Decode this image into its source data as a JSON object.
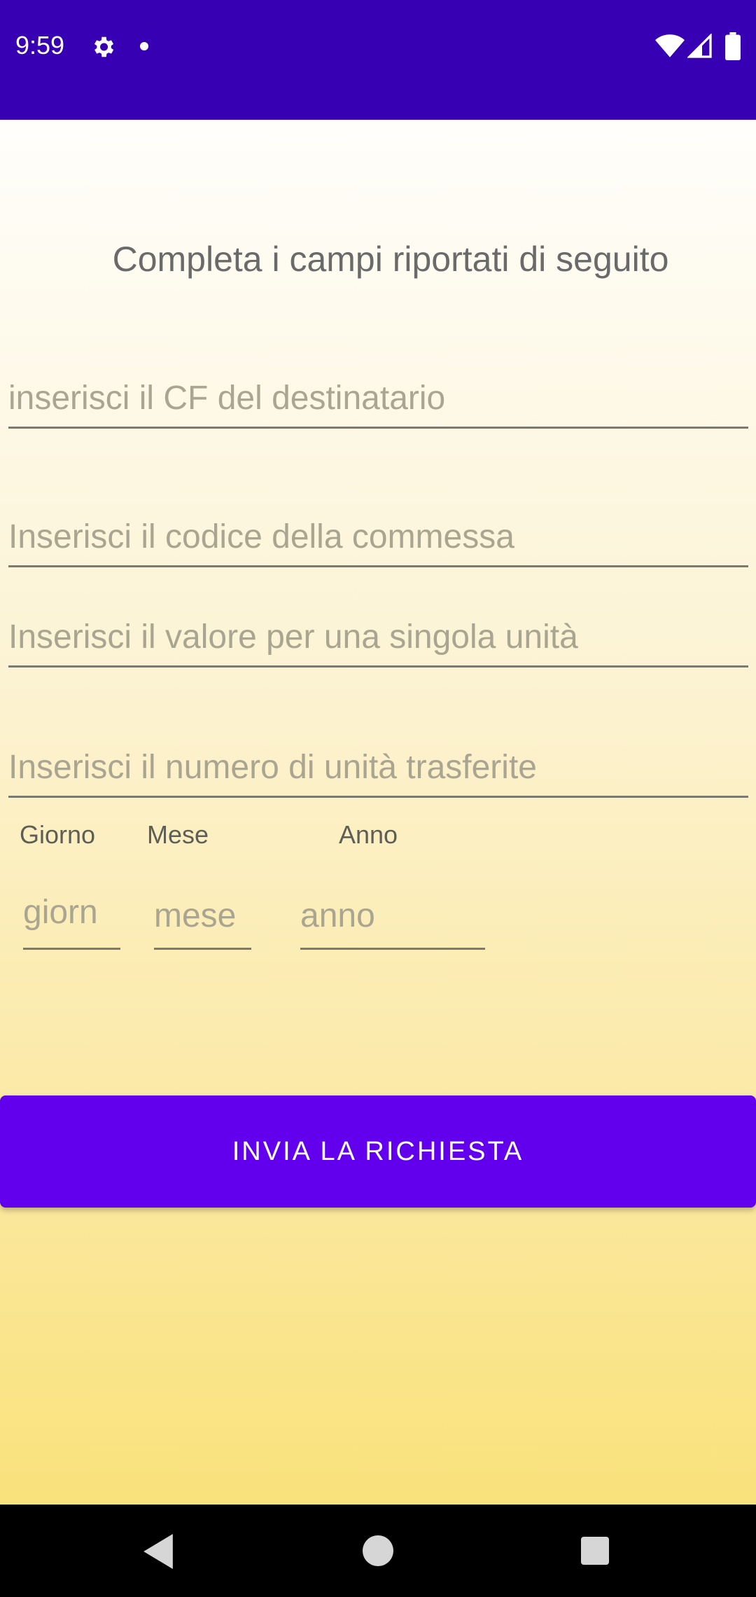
{
  "status_bar": {
    "time": "9:59",
    "icons": [
      "gear-icon",
      "notification-dot-icon",
      "wifi-icon",
      "signal-icon",
      "battery-icon"
    ]
  },
  "form": {
    "heading": "Completa i campi riportati di seguito",
    "cf_placeholder": "inserisci il CF del destinatario",
    "commessa_placeholder": "Inserisci il codice della commessa",
    "valore_placeholder": "Inserisci il valore per una singola unità",
    "numero_placeholder": "Inserisci il numero di unità trasferite",
    "date_labels": {
      "day": "Giorno",
      "month": "Mese",
      "year": "Anno"
    },
    "date_placeholders": {
      "day": "giorn",
      "month": "mese",
      "year": "anno"
    },
    "submit_label": "INVIA LA RICHIESTA"
  },
  "nav_bar": {
    "icons": [
      "back-icon",
      "home-icon",
      "recents-icon"
    ]
  },
  "colors": {
    "status_bar": "#3700b3",
    "button": "#6200ee",
    "gradient_top": "#fffefb",
    "gradient_bottom": "#f9e27b"
  }
}
